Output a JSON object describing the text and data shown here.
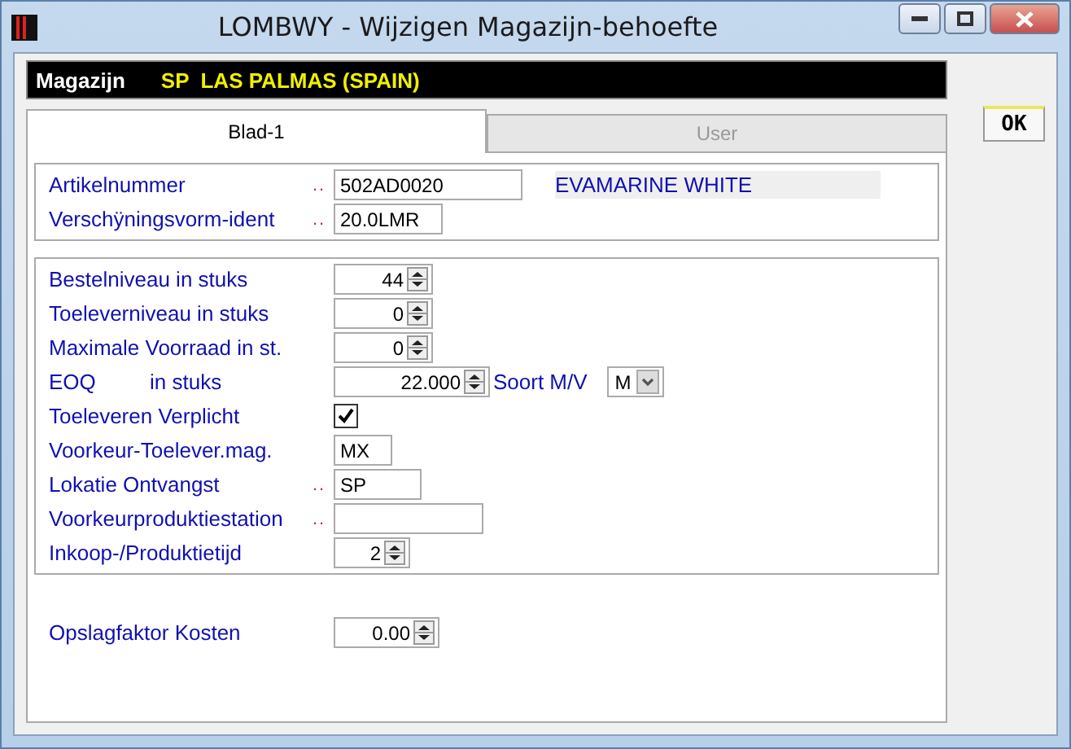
{
  "window": {
    "title": "LOMBWY - Wijzigen Magazijn-behoefte"
  },
  "header": {
    "label": "Magazijn",
    "value": "SP  LAS PALMAS (SPAIN)"
  },
  "tabs": [
    {
      "label": "Blad-1",
      "selected": true
    },
    {
      "label": "User",
      "selected": false
    }
  ],
  "ok_button": "OK",
  "article": {
    "rows": [
      {
        "kind": "text",
        "label": "Artikelnummer",
        "leader": "..",
        "value": "502AD0020",
        "description": "EVAMARINE WHITE"
      },
      {
        "kind": "text",
        "label": "Verschÿningsvorm-ident",
        "leader": "..",
        "value": "20.0LMR"
      }
    ]
  },
  "levels": {
    "rows": [
      {
        "kind": "spin",
        "label": "Bestelniveau in stuks",
        "value": "44"
      },
      {
        "kind": "spin",
        "label": "Toeleverniveau in stuks",
        "value": "0"
      },
      {
        "kind": "spin",
        "label": "Maximale Voorraad in st.",
        "value": "0"
      },
      {
        "kind": "eoq",
        "label": "EOQ",
        "label_2": "in stuks",
        "value": "22.000",
        "select_label": "Soort M/V",
        "select_value": "M"
      },
      {
        "kind": "check",
        "label": "Toeleveren Verplicht",
        "checked": true
      },
      {
        "kind": "text",
        "label": "Voorkeur-Toelever.mag.",
        "value": "MX"
      },
      {
        "kind": "text",
        "label": "Lokatie Ontvangst",
        "leader": "..",
        "value": "SP"
      },
      {
        "kind": "text",
        "label": "Voorkeurproduktiestation",
        "leader": ".."
      },
      {
        "kind": "spin",
        "label": "Inkoop-/Produktietijd",
        "value": "2"
      }
    ]
  },
  "costs": {
    "rows": [
      {
        "kind": "spin",
        "label": "Opslagfaktor Kosten",
        "value": "0.00"
      }
    ]
  }
}
